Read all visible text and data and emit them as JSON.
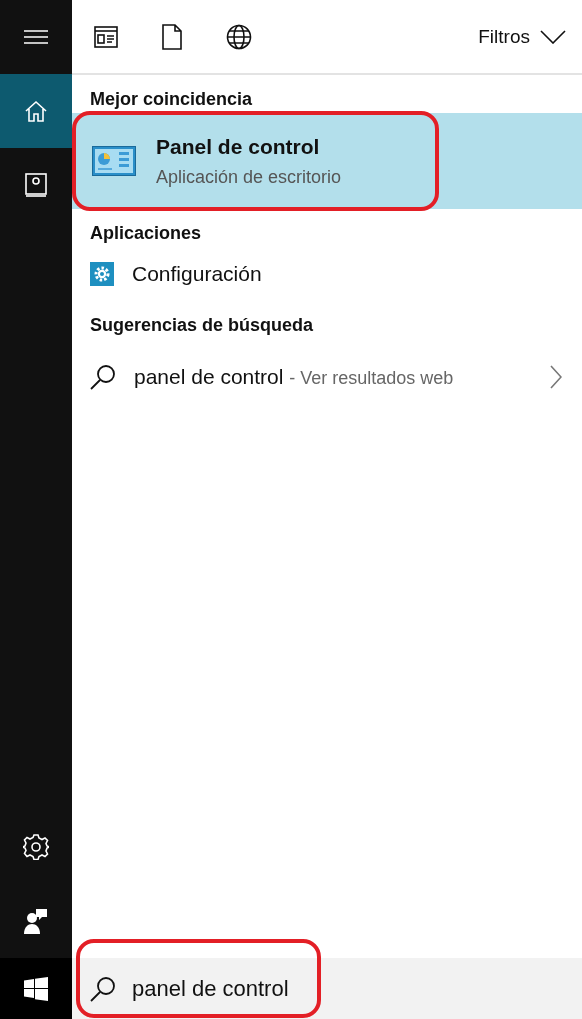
{
  "sidebar": {
    "top": [
      {
        "kind": "menu",
        "selected": false
      },
      {
        "kind": "home",
        "selected": true
      },
      {
        "kind": "notebook",
        "selected": false
      }
    ],
    "bottom": [
      {
        "kind": "settings",
        "selected": false
      },
      {
        "kind": "feedback",
        "selected": false
      }
    ]
  },
  "toolbar": {
    "icons": [
      {
        "kind": "apps"
      },
      {
        "kind": "documents"
      },
      {
        "kind": "web"
      }
    ],
    "filter_label": "Filtros"
  },
  "best_match": {
    "heading": "Mejor coincidencia",
    "title": "Panel de control",
    "subtitle": "Aplicación de escritorio",
    "selected": true,
    "highlighted": true
  },
  "apps": {
    "heading": "Aplicaciones",
    "items": [
      {
        "label": "Configuración"
      }
    ]
  },
  "suggestions": {
    "heading": "Sugerencias de búsqueda",
    "items": [
      {
        "query": "panel de control",
        "hint": "- Ver resultados web"
      }
    ]
  },
  "search": {
    "value": "panel de control",
    "highlighted": true
  }
}
